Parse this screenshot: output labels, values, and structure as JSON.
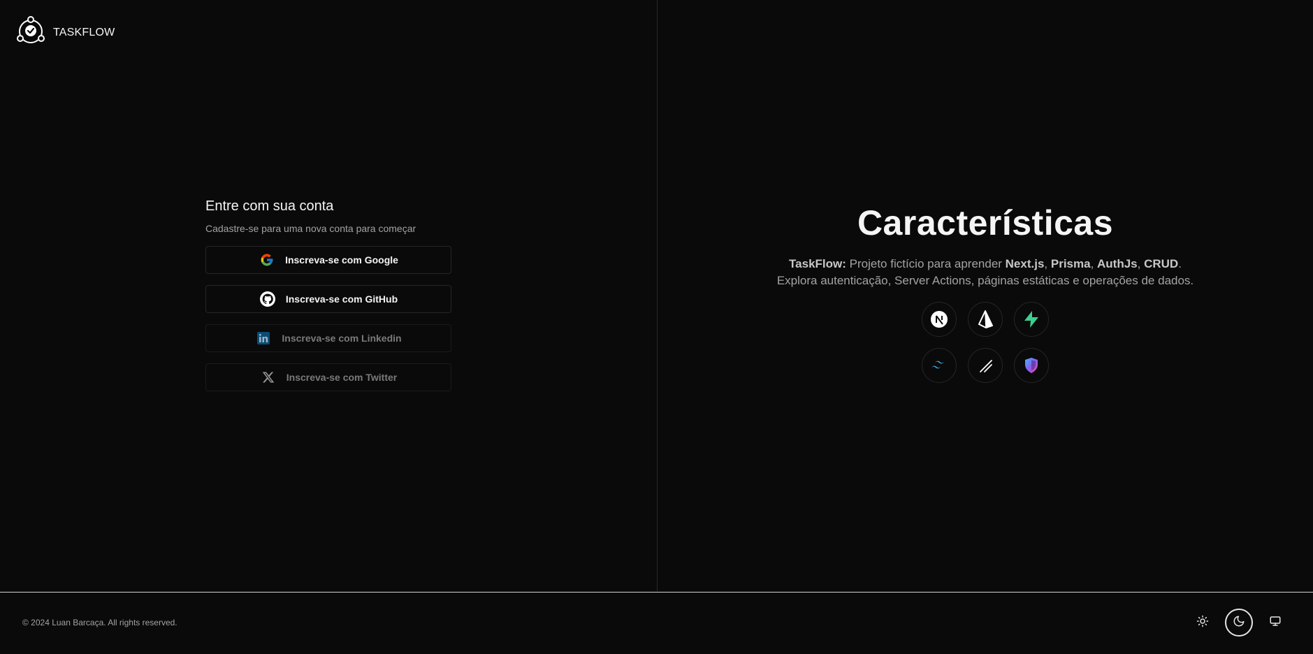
{
  "header": {
    "brand": "TASKFLOW",
    "logo_icon": "circle-check-logo-icon"
  },
  "login": {
    "title": "Entre com sua conta",
    "subtitle": "Cadastre-se para uma nova conta para começar",
    "buttons": [
      {
        "label": "Inscreva-se com Google",
        "icon": "google-icon",
        "enabled": true
      },
      {
        "label": "Inscreva-se com GitHub",
        "icon": "github-icon",
        "enabled": true
      },
      {
        "label": "Inscreva-se com Linkedin",
        "icon": "linkedin-icon",
        "enabled": false
      },
      {
        "label": "Inscreva-se com Twitter",
        "icon": "x-twitter-icon",
        "enabled": false
      }
    ]
  },
  "features": {
    "title": "Características",
    "desc": {
      "brand": "TaskFlow:",
      "part1": " Projeto fictício para aprender ",
      "tech1": "Next.js",
      "sep1": ", ",
      "tech2": "Prisma",
      "sep2": ", ",
      "tech3": "AuthJs",
      "sep3": ", ",
      "tech4": "CRUD",
      "part2": ". Explora autenticação, Server Actions, páginas estáticas e operações de dados."
    },
    "tech_icons": [
      "nextjs-icon",
      "prisma-icon",
      "supabase-icon",
      "tailwind-icon",
      "shadcn-icon",
      "authjs-icon"
    ]
  },
  "footer": {
    "copyright": "© 2024 Luan Barcaça. All rights reserved.",
    "theme_options": [
      "sun-icon",
      "moon-icon",
      "monitor-icon"
    ],
    "active_theme": "moon-icon"
  },
  "colors": {
    "background": "#0a0a0a",
    "google_blue": "#4285F4",
    "google_red": "#EA4335",
    "google_yellow": "#FBBC05",
    "google_green": "#34A853",
    "supabase_green": "#3ECF8E",
    "tailwind_cyan": "#38BDF8"
  }
}
